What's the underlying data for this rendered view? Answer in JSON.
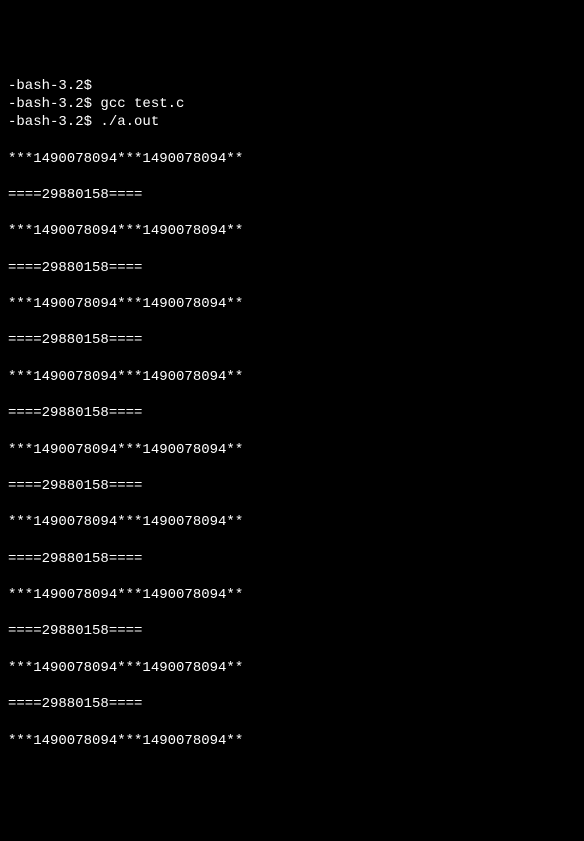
{
  "terminal": {
    "lines": [
      "-bash-3.2$",
      "-bash-3.2$ gcc test.c",
      "-bash-3.2$ ./a.out",
      "",
      "***1490078094***1490078094**",
      "",
      "====29880158====",
      "",
      "***1490078094***1490078094**",
      "",
      "====29880158====",
      "",
      "***1490078094***1490078094**",
      "",
      "====29880158====",
      "",
      "***1490078094***1490078094**",
      "",
      "====29880158====",
      "",
      "***1490078094***1490078094**",
      "",
      "====29880158====",
      "",
      "***1490078094***1490078094**",
      "",
      "====29880158====",
      "",
      "***1490078094***1490078094**",
      "",
      "====29880158====",
      "",
      "***1490078094***1490078094**",
      "",
      "====29880158====",
      "",
      "***1490078094***1490078094**"
    ]
  }
}
